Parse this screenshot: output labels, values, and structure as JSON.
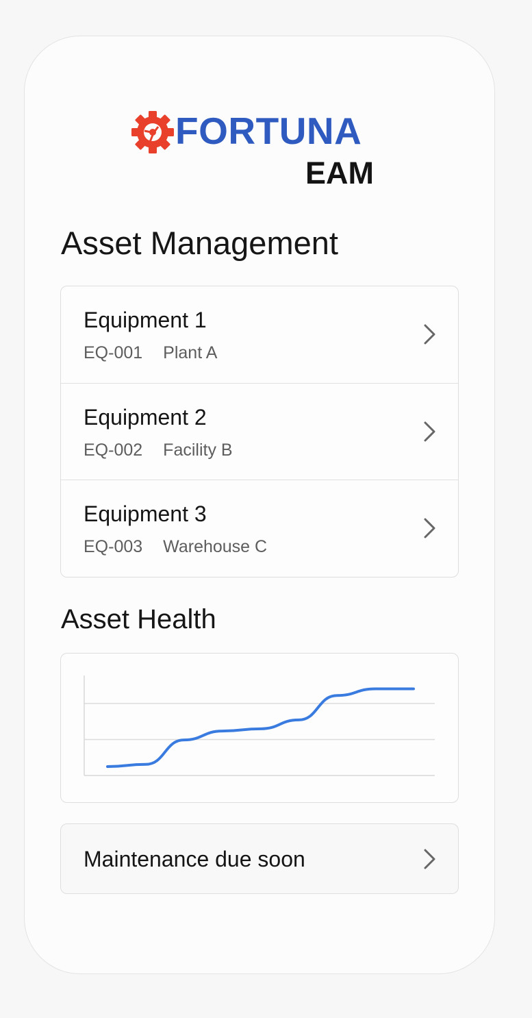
{
  "brand": {
    "name": "FORTUNA",
    "product": "EAM",
    "colors": {
      "primary": "#2f5bc0",
      "gear": "#e8402a"
    },
    "icon": "gear-logo-icon"
  },
  "asset_management": {
    "title": "Asset Management",
    "items": [
      {
        "name": "Equipment 1",
        "code": "EQ-001",
        "location": "Plant A",
        "icon": "chevron-right-icon"
      },
      {
        "name": "Equipment 2",
        "code": "EQ-002",
        "location": "Facility B",
        "icon": "chevron-right-icon"
      },
      {
        "name": "Equipment 3",
        "code": "EQ-003",
        "location": "Warehouse C",
        "icon": "chevron-right-icon"
      }
    ]
  },
  "asset_health": {
    "title": "Asset Health",
    "line_color": "#3a7be0"
  },
  "chart_data": {
    "type": "line",
    "title": "",
    "xlabel": "",
    "ylabel": "",
    "x": [
      0,
      1,
      2,
      3,
      4,
      5,
      6,
      7,
      8
    ],
    "series": [
      {
        "values": [
          0.4,
          0.5,
          1.6,
          2.0,
          2.1,
          2.5,
          3.6,
          3.9,
          3.9
        ]
      }
    ],
    "ylim": [
      0,
      4.5
    ],
    "grid": true
  },
  "maintenance": {
    "label": "Maintenance due soon",
    "icon": "chevron-right-icon"
  }
}
